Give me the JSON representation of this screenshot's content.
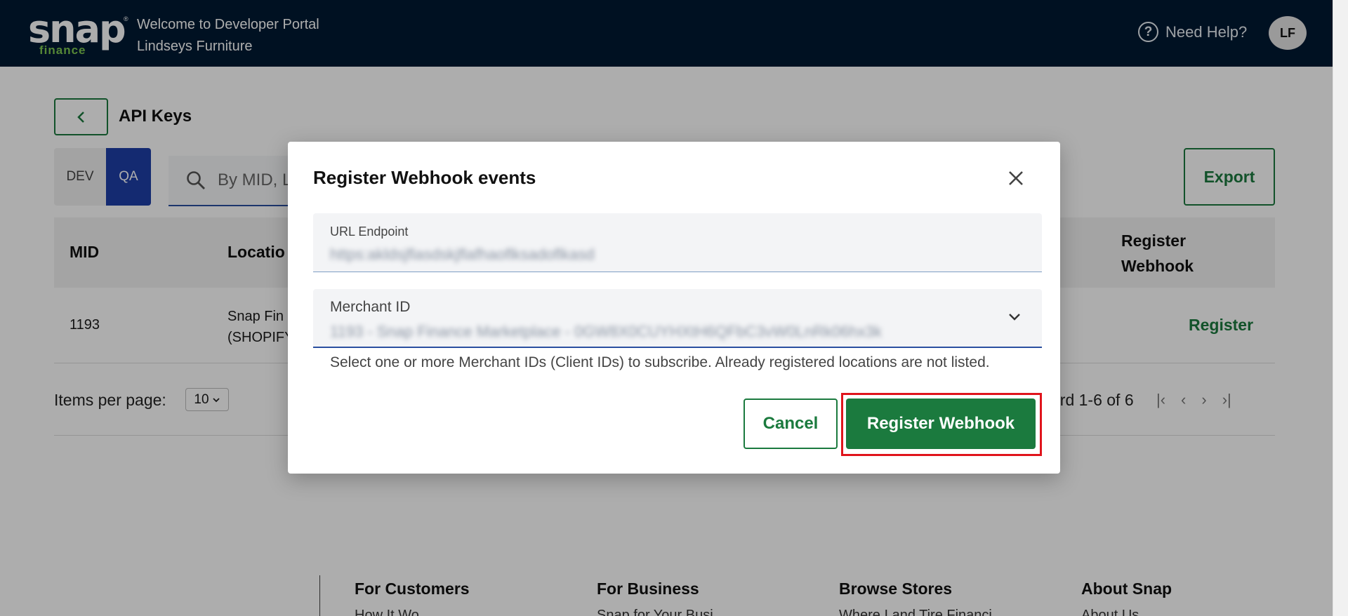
{
  "header": {
    "logo_text": "snap",
    "logo_sub": "finance",
    "welcome": "Welcome to Developer Portal",
    "merchant": "Lindseys Furniture",
    "help_label": "Need Help?",
    "avatar_initials": "LF"
  },
  "page": {
    "title": "API Keys",
    "env": {
      "dev": "DEV",
      "qa": "QA",
      "selected": "QA"
    },
    "search_placeholder": "By MID, L",
    "export_label": "Export"
  },
  "table": {
    "columns": {
      "mid": "MID",
      "location": "Locatio",
      "register_line1": "Register",
      "register_line2": "Webhook"
    },
    "rows": [
      {
        "mid": "1193",
        "location_line1": "Snap Fin",
        "location_line2": "(SHOPIFY",
        "action": "Register"
      }
    ]
  },
  "pagination": {
    "items_per_page_label": "Items per page:",
    "items_per_page_value": "10",
    "range_text": "ord 1-6 of 6"
  },
  "footer": {
    "columns": [
      {
        "title": "For Customers",
        "sub": "How It Wo"
      },
      {
        "title": "For Business",
        "sub": "Snap for Your Busi"
      },
      {
        "title": "Browse Stores",
        "sub": "Where I and Tire Financi"
      },
      {
        "title": "About Snap",
        "sub": "About Us"
      }
    ]
  },
  "modal": {
    "title": "Register Webhook events",
    "url_label": "URL Endpoint",
    "url_value": "https:akldsjflasdskjflafhaoflksadoflkasd",
    "merchant_label": "Merchant ID",
    "merchant_value": "1193 - Snap Finance Marketplace - 0GW8X0CUYHXtH6QFbC3vW0LnRk06hx3k",
    "hint": "Select one or more Merchant IDs (Client IDs) to subscribe. Already registered locations are not listed.",
    "cancel_label": "Cancel",
    "submit_label": "Register Webhook"
  },
  "colors": {
    "header_bg": "#011a33",
    "brand_green": "#1b7a3e",
    "qa_blue": "#1e3fa7",
    "highlight_red": "#e0141c"
  }
}
